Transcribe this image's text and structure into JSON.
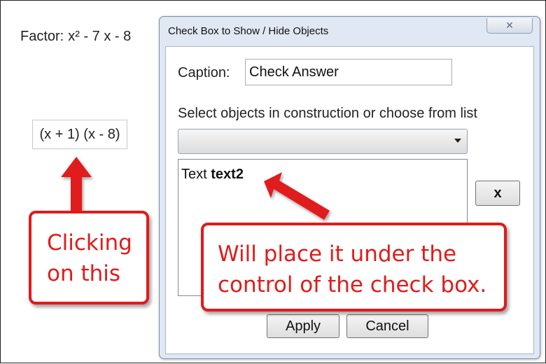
{
  "background": {
    "factor_label": "Factor:",
    "factor_expression": "x² - 7 x - 8",
    "answer_text": "(x + 1) (x - 8)"
  },
  "dialog": {
    "title": "Check Box to Show / Hide Objects",
    "close_label": "✕",
    "caption_label": "Caption:",
    "caption_value": "Check Answer",
    "select_label": "Select objects in construction or choose from list",
    "combo_value": "",
    "list_items": [
      {
        "prefix": "Text",
        "name": "text2"
      }
    ],
    "remove_label": "x",
    "apply_label": "Apply",
    "cancel_label": "Cancel"
  },
  "callouts": {
    "left_line1": "Clicking",
    "left_line2": "on this",
    "right_line1": "Will place it under the",
    "right_line2": "control of the check box."
  },
  "colors": {
    "annotation_red": "#e01b1b",
    "dialog_frame": "#dfe8f3"
  },
  "icons": {
    "close": "close-icon",
    "dropdown": "chevron-down-icon"
  }
}
